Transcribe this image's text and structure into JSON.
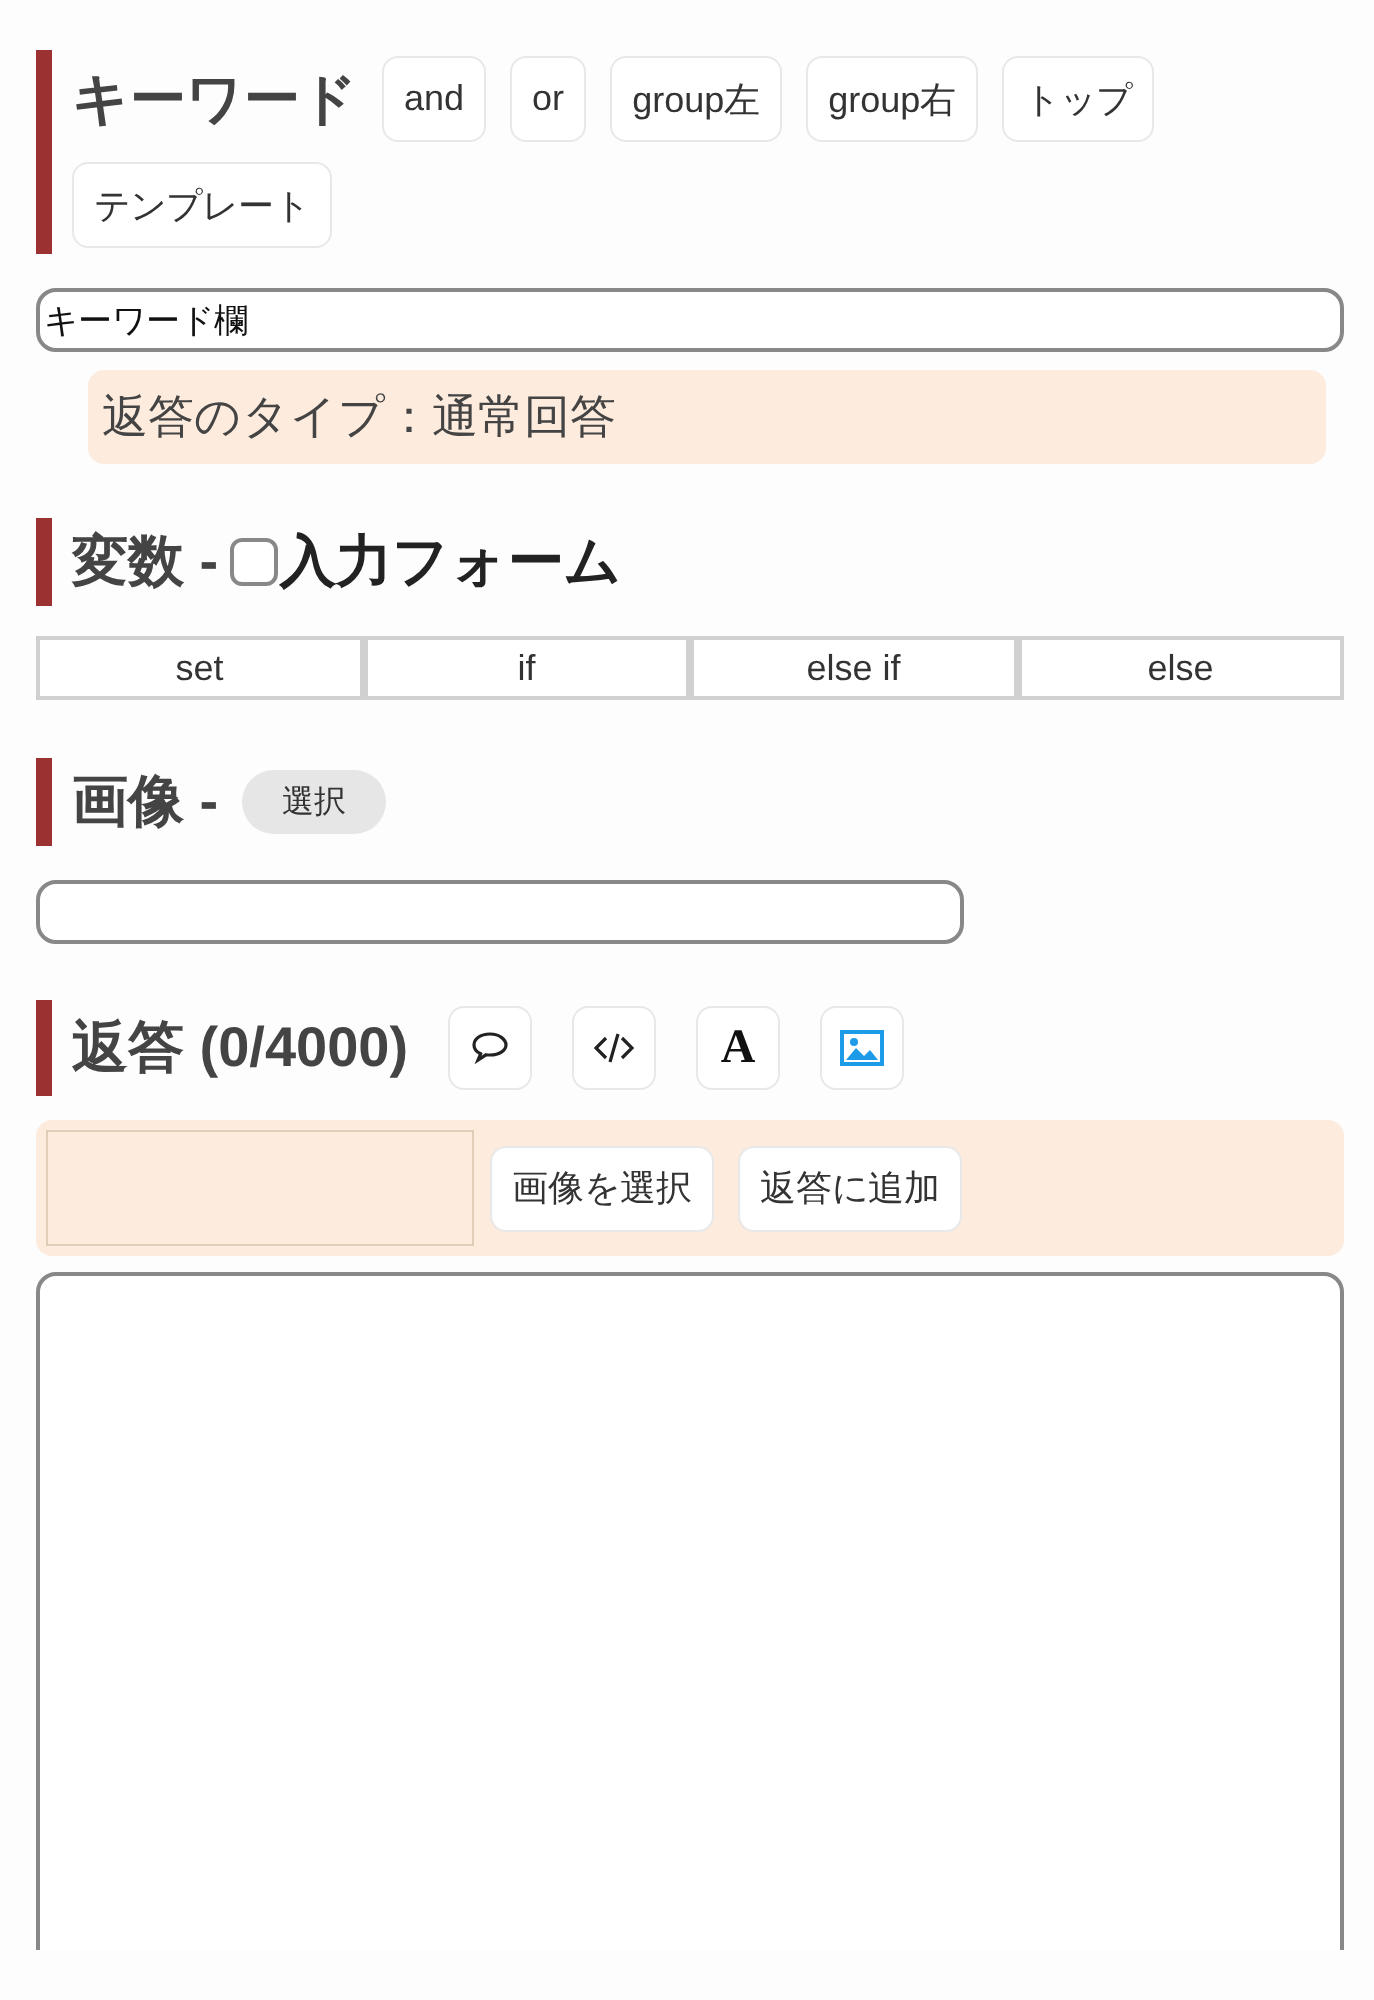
{
  "keyword": {
    "title": "キーワード",
    "buttons": [
      "and",
      "or",
      "group左",
      "group右",
      "トップ",
      "テンプレート"
    ]
  },
  "keyword_field": {
    "value": "キーワード欄"
  },
  "reply_type": "返答のタイプ：通常回答",
  "variables": {
    "title": "変数 -",
    "input_form": {
      "label": "入力フォーム",
      "checked": false
    },
    "buttons": [
      "set",
      "if",
      "else if",
      "else"
    ]
  },
  "image": {
    "title": "画像 -",
    "select_button": "選択"
  },
  "reply": {
    "title": "返答 (0/4000)",
    "tools": [
      {
        "kind": "speech"
      },
      {
        "kind": "code"
      },
      {
        "kind": "font",
        "glyph": "A"
      },
      {
        "kind": "image"
      }
    ],
    "image_buttons": [
      "画像を選択",
      "返答に追加"
    ]
  }
}
